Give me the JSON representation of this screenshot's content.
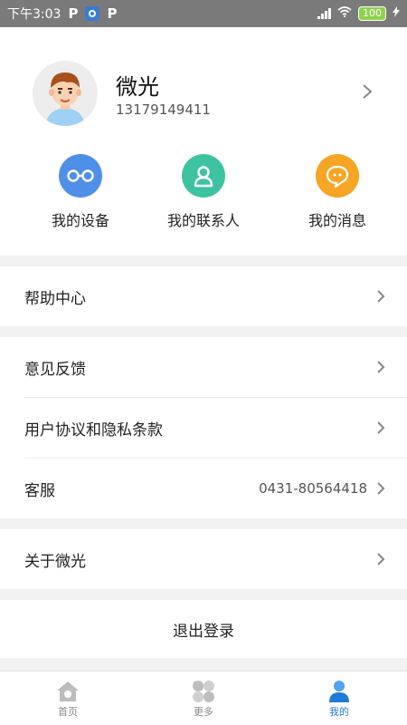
{
  "status_bar": {
    "time": "下午3:03",
    "battery": "100"
  },
  "profile": {
    "name": "微光",
    "phone": "13179149411"
  },
  "shortcuts": [
    {
      "label": "我的设备",
      "icon": "glasses-icon",
      "color": "#4f8fe8"
    },
    {
      "label": "我的联系人",
      "icon": "contact-icon",
      "color": "#3ec3a0"
    },
    {
      "label": "我的消息",
      "icon": "chat-icon",
      "color": "#f7a524"
    }
  ],
  "menu": {
    "help": "帮助中心",
    "feedback": "意见反馈",
    "agreement": "用户协议和隐私条款",
    "service": "客服",
    "service_phone": "0431-80564418",
    "about": "关于微光"
  },
  "logout": "退出登录",
  "tabs": [
    {
      "label": "首页",
      "icon": "home-icon"
    },
    {
      "label": "更多",
      "icon": "more-icon"
    },
    {
      "label": "我的",
      "icon": "user-icon",
      "active": true
    }
  ],
  "colors": {
    "accent": "#1f7bd8",
    "background": "#f2f2f2",
    "status_bar": "#7a7a7a"
  }
}
